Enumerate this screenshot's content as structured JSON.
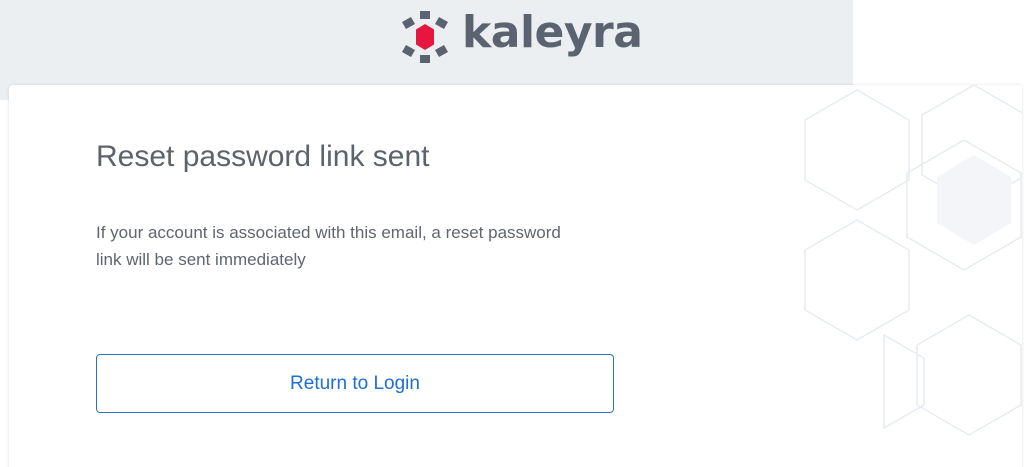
{
  "brand": {
    "name": "kaleyra",
    "logo_icon": "kaleyra-hexagon-icon",
    "text_color": "#5c6370",
    "accent_color": "#e5173f"
  },
  "card": {
    "title": "Reset password link sent",
    "message": "If your account is associated with this email, a reset password link will be sent immediately",
    "button_label": "Return to Login",
    "button_color": "#1c6fd8"
  },
  "background": {
    "band_color": "#eceff2",
    "decoration_icon": "hexagon-pattern-icon"
  }
}
